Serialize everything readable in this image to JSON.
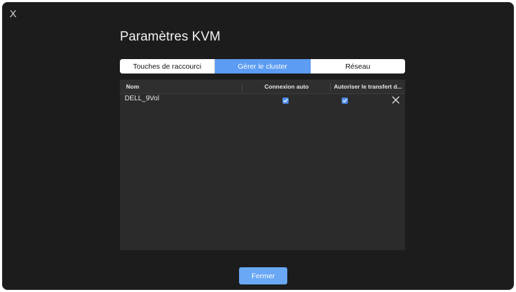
{
  "window": {
    "close_icon_glyph": "X",
    "title": "Paramètres KVM"
  },
  "tabs": [
    {
      "label": "Touches de raccourci",
      "active": false
    },
    {
      "label": "Gérer le cluster",
      "active": true
    },
    {
      "label": "Réseau",
      "active": false
    }
  ],
  "table": {
    "columns": [
      "Nom",
      "Connexion auto",
      "Autoriser le transfert d..."
    ],
    "rows": [
      {
        "name": "DELL_9Vol",
        "connexion_auto": true,
        "autoriser_transfert": true
      }
    ]
  },
  "footer": {
    "close_label": "Fermer"
  },
  "colors": {
    "accent": "#5c9cf2",
    "checkbox": "#4f8ff0",
    "background": "#1c1c1c",
    "table_bg": "#2b2b2b"
  },
  "icons": {
    "window_close": "close-icon",
    "row_remove": "remove-icon",
    "checkbox": "checkmark-icon"
  }
}
